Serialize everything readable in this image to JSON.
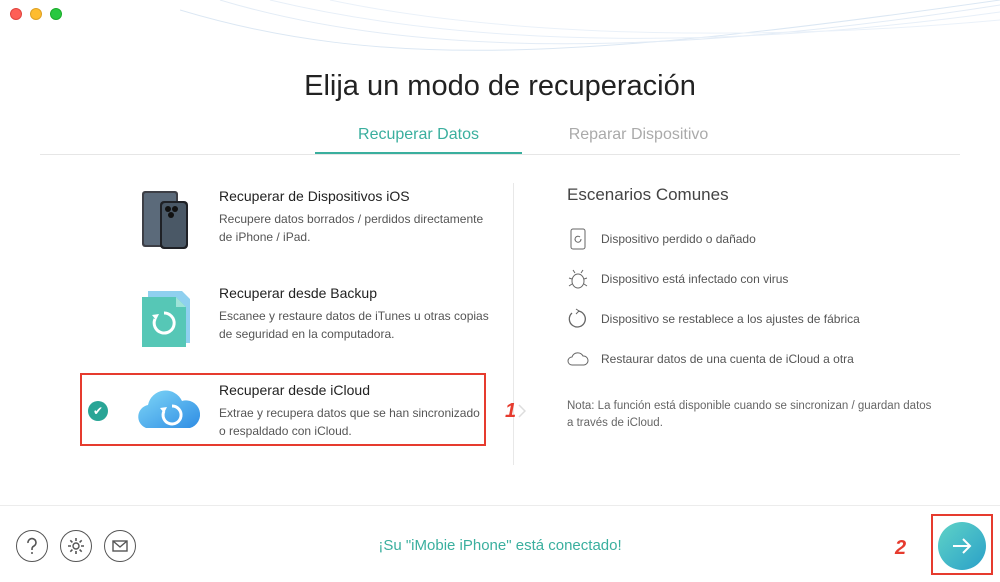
{
  "page": {
    "title": "Elija un modo de recuperación"
  },
  "tabs": [
    {
      "label": "Recuperar Datos",
      "active": true
    },
    {
      "label": "Reparar Dispositivo",
      "active": false
    }
  ],
  "options": [
    {
      "title": "Recuperar de Dispositivos iOS",
      "description": "Recupere datos borrados / perdidos directamente de iPhone / iPad.",
      "icon": "iphone-icon"
    },
    {
      "title": "Recuperar desde Backup",
      "description": "Escanee y restaure datos de iTunes u otras copias de seguridad en la computadora.",
      "icon": "backup-icon"
    },
    {
      "title": "Recuperar desde iCloud",
      "description": "Extrae y recupera datos que se han sincronizado o respaldado con iCloud.",
      "icon": "icloud-icon",
      "selected": true
    }
  ],
  "scenarios": {
    "title": "Escenarios Comunes",
    "items": [
      {
        "label": "Dispositivo perdido o dañado",
        "icon": "phone-refresh-icon"
      },
      {
        "label": "Dispositivo está infectado con virus",
        "icon": "bug-icon"
      },
      {
        "label": "Dispositivo se restablece a los ajustes de fábrica",
        "icon": "reset-icon"
      },
      {
        "label": "Restaurar datos de una cuenta de iCloud a otra",
        "icon": "cloud-icon"
      }
    ],
    "note": "Nota: La función está disponible cuando se sincronizan / guardan datos a través de iCloud."
  },
  "annotations": {
    "marker1": "1",
    "marker2": "2"
  },
  "footer": {
    "status": "¡Su \"iMobie iPhone\" está conectado!",
    "help_icon": "question-icon",
    "settings_icon": "gear-icon",
    "mail_icon": "mail-icon",
    "next_icon": "arrow-right-icon"
  },
  "colors": {
    "accent": "#3aaf9e",
    "highlight": "#e63b2e"
  }
}
